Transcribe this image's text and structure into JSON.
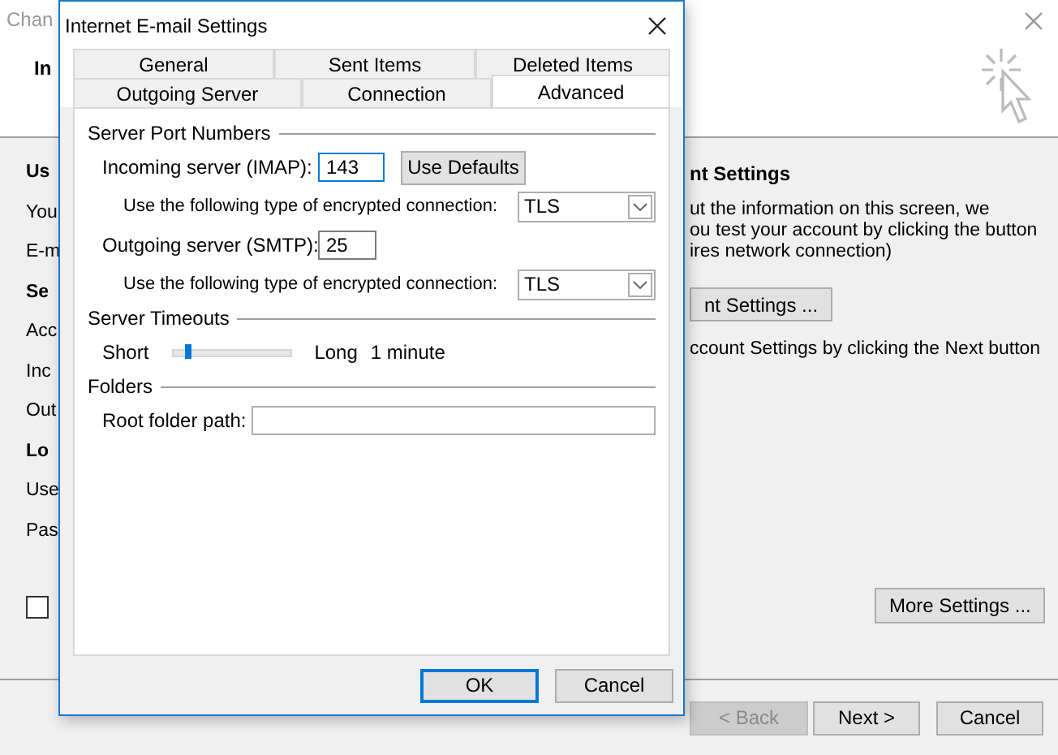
{
  "background": {
    "title": "Chan",
    "heading": "In",
    "left_labels": [
      {
        "text": "Us",
        "bold": true
      },
      {
        "text": "You",
        "bold": false
      },
      {
        "text": "E-m",
        "bold": false
      },
      {
        "text": "Se",
        "bold": true
      },
      {
        "text": "Acc",
        "bold": false
      },
      {
        "text": "Inc",
        "bold": false
      },
      {
        "text": "Out",
        "bold": false
      },
      {
        "text": "Lo",
        "bold": true
      },
      {
        "text": "Use",
        "bold": false
      },
      {
        "text": "Pas",
        "bold": false
      }
    ],
    "remember_checkbox": {
      "checked": false
    },
    "right_heading": "nt Settings",
    "right_lines": [
      "ut the information on this screen, we",
      "ou test your account by clicking the button",
      "ires network connection)"
    ],
    "test_button": "nt Settings ...",
    "right_note": "ccount Settings by clicking the Next button",
    "more_button": "More Settings ...",
    "nav_buttons": [
      {
        "label": "< Back",
        "disabled": true
      },
      {
        "label": "Next >",
        "disabled": false
      },
      {
        "label": "Cancel",
        "disabled": false
      }
    ]
  },
  "dialog": {
    "title": "Internet E-mail Settings",
    "tab_rows": [
      [
        {
          "label": "General",
          "selected": false
        },
        {
          "label": "Sent Items",
          "selected": false
        },
        {
          "label": "Deleted Items",
          "selected": false
        }
      ],
      [
        {
          "label": "Outgoing Server",
          "selected": false
        },
        {
          "label": "Connection",
          "selected": false
        },
        {
          "label": "Advanced",
          "selected": true
        }
      ]
    ],
    "port_numbers": {
      "title": "Server Port Numbers",
      "incoming_label": "Incoming server (IMAP):",
      "incoming_value": "143",
      "defaults_button": "Use Defaults",
      "incoming_encryption_label": "Use the following type of encrypted connection:",
      "incoming_encryption": "TLS",
      "outgoing_label": "Outgoing server (SMTP):",
      "outgoing_value": "25",
      "outgoing_encryption_label": "Use the following type of encrypted connection:",
      "outgoing_encryption": "TLS"
    },
    "timeouts": {
      "title": "Server Timeouts",
      "min_label": "Short",
      "max_label": "Long",
      "level": 0.1,
      "reading": "1 minute"
    },
    "folders": {
      "title": "Folders",
      "root_label": "Root folder path:"
    },
    "buttons": [
      {
        "label": "OK",
        "default": true
      },
      {
        "label": "Cancel",
        "default": false
      }
    ]
  }
}
